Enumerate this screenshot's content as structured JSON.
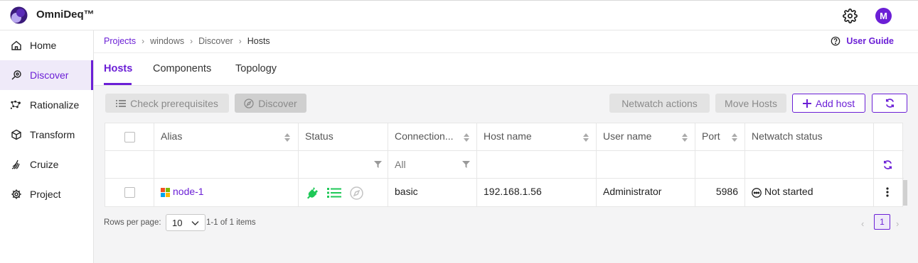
{
  "app": {
    "brand": "OmniDeq™",
    "avatar_initial": "M"
  },
  "colors": {
    "accent": "#6b1fd6",
    "success": "#1ec857"
  },
  "sidebar": {
    "items": [
      {
        "label": "Home",
        "icon": "home-icon"
      },
      {
        "label": "Discover",
        "icon": "discover-icon",
        "active": true
      },
      {
        "label": "Rationalize",
        "icon": "rationalize-icon"
      },
      {
        "label": "Transform",
        "icon": "cube-icon"
      },
      {
        "label": "Cruize",
        "icon": "cruize-icon"
      },
      {
        "label": "Project",
        "icon": "gear-icon"
      }
    ]
  },
  "breadcrumb": {
    "items": [
      "Projects",
      "windows",
      "Discover",
      "Hosts"
    ]
  },
  "header": {
    "user_guide": "User Guide"
  },
  "tabs": [
    {
      "label": "Hosts",
      "active": true
    },
    {
      "label": "Components"
    },
    {
      "label": "Topology"
    }
  ],
  "toolbar": {
    "check_prerequisites": "Check prerequisites",
    "discover": "Discover",
    "netwatch_actions": "Netwatch actions",
    "move_hosts": "Move Hosts",
    "add_host": "Add host"
  },
  "table": {
    "columns": [
      "Alias",
      "Status",
      "Connection...",
      "Host name",
      "User name",
      "Port",
      "Netwatch status"
    ],
    "filter_connection": "All",
    "rows": [
      {
        "alias": "node-1",
        "connection": "basic",
        "host_name": "192.168.1.56",
        "user_name": "Administrator",
        "port": "5986",
        "netwatch_status": "Not started"
      }
    ]
  },
  "pagination": {
    "rows_per_page_label": "Rows per page:",
    "rows_per_page": "10",
    "items_summary": "1-1 of 1 items",
    "current_page": "1"
  }
}
